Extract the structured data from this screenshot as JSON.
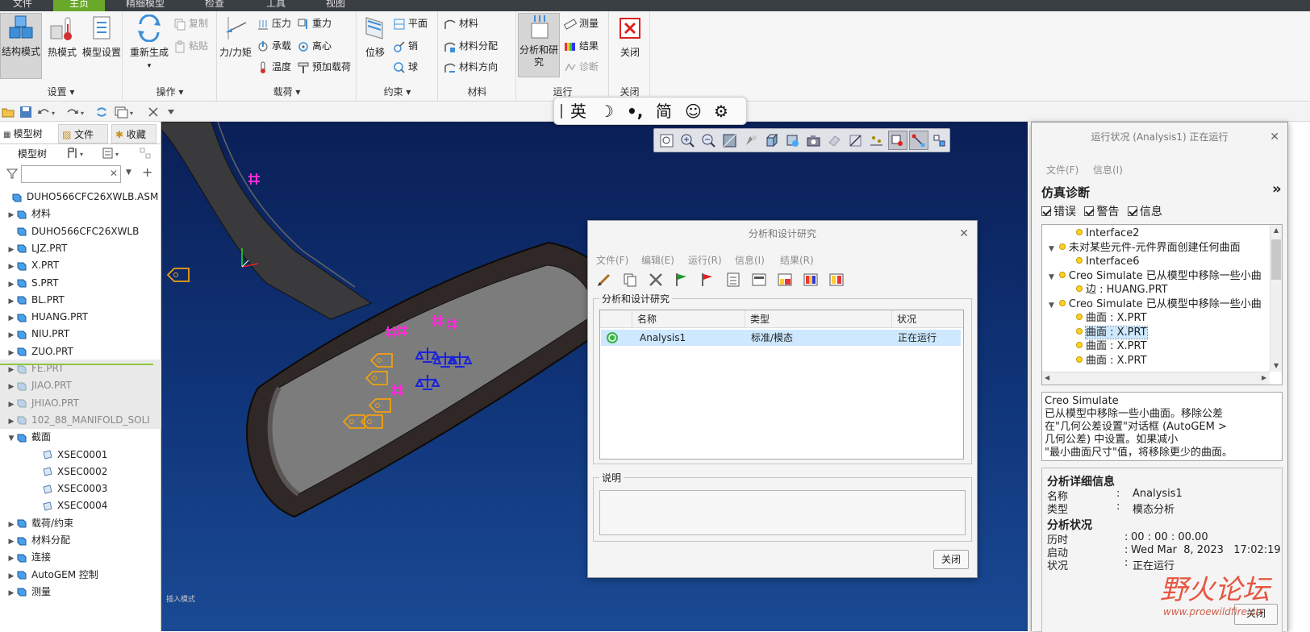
{
  "menubar": {
    "tabs": [
      "文件",
      "主页",
      "精细模型",
      "检查",
      "工具",
      "视图"
    ]
  },
  "ribbon": {
    "groups": {
      "setup": "设置",
      "operations": "操作",
      "loads": "载荷",
      "constraints": "约束",
      "material": "材料",
      "run": "运行",
      "close": "关闭"
    },
    "buttons": {
      "structure_mode": "结构模式",
      "thermal_mode": "热模式",
      "model_setup": "模型设置",
      "regenerate": "重新生成",
      "copy": "复制",
      "paste": "粘贴",
      "force_moment": "力/力矩",
      "pressure": "压力",
      "gravity": "重力",
      "bearing": "承载",
      "centrifugal": "离心",
      "temperature": "温度",
      "preload": "预加载荷",
      "displacement": "位移",
      "plane": "平面",
      "pin": "销",
      "ball": "球",
      "material": "材料",
      "material_assign": "材料分配",
      "material_orient": "材料方向",
      "analysis_study_1": "分析和研",
      "analysis_study_2": "究",
      "measure": "测量",
      "results": "结果",
      "diagnose": "诊断",
      "close": "关闭"
    }
  },
  "ime": {
    "items": [
      "英",
      "☽",
      "•,",
      "简",
      "☺",
      "⚙"
    ]
  },
  "left_panel": {
    "tabs": [
      "模型树",
      "文件",
      "收藏"
    ],
    "tree_label": "模型树",
    "search_placeholder": "",
    "items": [
      {
        "label": "DUHO566CFC26XWLB.ASM",
        "level": 0,
        "toggle": "",
        "gray": false
      },
      {
        "label": "材料",
        "level": 1,
        "toggle": "▶",
        "gray": false
      },
      {
        "label": "DUHO566CFC26XWLB",
        "level": 1,
        "toggle": "",
        "gray": false
      },
      {
        "label": "LJZ.PRT",
        "level": 1,
        "toggle": "▶",
        "gray": false
      },
      {
        "label": "X.PRT",
        "level": 1,
        "toggle": "▶",
        "gray": false
      },
      {
        "label": "S.PRT",
        "level": 1,
        "toggle": "▶",
        "gray": false
      },
      {
        "label": "BL.PRT",
        "level": 1,
        "toggle": "▶",
        "gray": false
      },
      {
        "label": "HUANG.PRT",
        "level": 1,
        "toggle": "▶",
        "gray": false
      },
      {
        "label": "NIU.PRT",
        "level": 1,
        "toggle": "▶",
        "gray": false
      },
      {
        "label": "ZUO.PRT",
        "level": 1,
        "toggle": "▶",
        "gray": false
      },
      {
        "label": "FE.PRT",
        "level": 1,
        "toggle": "▶",
        "gray": true
      },
      {
        "label": "JIAO.PRT",
        "level": 1,
        "toggle": "▶",
        "gray": true
      },
      {
        "label": "JHIAO.PRT",
        "level": 1,
        "toggle": "▶",
        "gray": true
      },
      {
        "label": "102_88_MANIFOLD_SOLI",
        "level": 1,
        "toggle": "▶",
        "gray": true
      },
      {
        "label": "截面",
        "level": 1,
        "toggle": "▼",
        "gray": false
      },
      {
        "label": "XSEC0001",
        "level": 2,
        "toggle": "",
        "gray": false
      },
      {
        "label": "XSEC0002",
        "level": 2,
        "toggle": "",
        "gray": false
      },
      {
        "label": "XSEC0003",
        "level": 2,
        "toggle": "",
        "gray": false
      },
      {
        "label": "XSEC0004",
        "level": 2,
        "toggle": "",
        "gray": false
      },
      {
        "label": "载荷/约束",
        "level": 1,
        "toggle": "▶",
        "gray": false
      },
      {
        "label": "材料分配",
        "level": 1,
        "toggle": "▶",
        "gray": false
      },
      {
        "label": "连接",
        "level": 1,
        "toggle": "▶",
        "gray": false
      },
      {
        "label": "AutoGEM 控制",
        "level": 1,
        "toggle": "▶",
        "gray": false
      },
      {
        "label": "测量",
        "level": 1,
        "toggle": "▶",
        "gray": false
      }
    ]
  },
  "viewport": {
    "mode_text": "插入模式"
  },
  "study_dialog": {
    "title": "分析和设计研究",
    "menus": [
      "文件(F)",
      "编辑(E)",
      "运行(R)",
      "信息(I)",
      "结果(R)"
    ],
    "section_label": "分析和设计研究",
    "columns": [
      "名称",
      "类型",
      "状况"
    ],
    "rows": [
      {
        "name": "Analysis1",
        "type": "标准/模态",
        "status": "正在运行"
      }
    ],
    "desc_label": "说明",
    "close_button": "关闭"
  },
  "status_dialog": {
    "title": "运行状况 (Analysis1) 正在运行",
    "menus": [
      "文件(F)",
      "信息(I)"
    ],
    "diag_title": "仿真诊断",
    "expand": "»",
    "filters": [
      "错误",
      "警告",
      "信息"
    ],
    "diag_rows": [
      {
        "text": "Interface2",
        "indent": 1,
        "toggle": "",
        "selected": false
      },
      {
        "text": "未对某些元件-元件界面创建任何曲面",
        "indent": 0,
        "toggle": "▼",
        "selected": false
      },
      {
        "text": "Interface6",
        "indent": 1,
        "toggle": "",
        "selected": false
      },
      {
        "text": "Creo Simulate 已从模型中移除一些小曲",
        "indent": 0,
        "toggle": "▼",
        "selected": false
      },
      {
        "text": "边 : HUANG.PRT",
        "indent": 1,
        "toggle": "",
        "selected": false
      },
      {
        "text": "Creo Simulate 已从模型中移除一些小曲",
        "indent": 0,
        "toggle": "▼",
        "selected": false
      },
      {
        "text": "曲面 : X.PRT",
        "indent": 1,
        "toggle": "",
        "selected": false
      },
      {
        "text": "曲面 : X.PRT",
        "indent": 1,
        "toggle": "",
        "selected": true
      },
      {
        "text": "曲面 : X.PRT",
        "indent": 1,
        "toggle": "",
        "selected": false
      },
      {
        "text": "曲面 : X.PRT",
        "indent": 1,
        "toggle": "",
        "selected": false
      }
    ],
    "message_lines": [
      "Creo Simulate",
      "已从模型中移除一些小曲面。移除公差",
      "在\"几何公差设置\"对话框 (AutoGEM >",
      "几何公差) 中设置。如果减小",
      "\"最小曲面尺寸\"值，将移除更少的曲面。"
    ],
    "details_title": "分析详细信息",
    "name_label": "名称",
    "name_value": "Analysis1",
    "type_label": "类型",
    "type_value": "模态分析",
    "status_title": "分析状况",
    "elapsed_label": "历时",
    "elapsed_value": "00 : 00 : 00.00",
    "start_label": "启动",
    "start_value": "Wed Mar  8, 2023   17:02:19",
    "state_label": "状况",
    "state_value": "正在运行",
    "close_button": "关闭"
  },
  "watermark": {
    "brand": "野火论坛",
    "url": "www.proewildfire.cn"
  },
  "colors": {
    "accent_tab": "#6aa82a",
    "viewport_top": "#0a1f56",
    "selection": "#cde8ff",
    "constraint": "#ff2bd6",
    "load": "#f0a010",
    "measure": "#1a24d8"
  }
}
